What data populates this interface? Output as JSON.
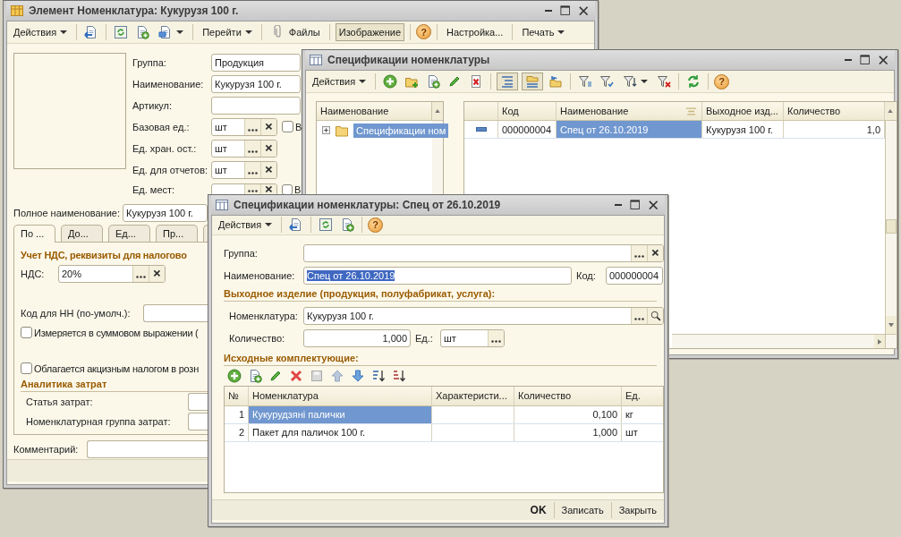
{
  "item_window": {
    "title": "Элемент Номенклатура: Кукурузя 100 г.",
    "toolbar": {
      "actions": "Действия",
      "goto": "Перейти",
      "files": "Файлы",
      "image": {
        "label": "Изображение",
        "pressed": true
      },
      "help": "?",
      "settings": "Настройка...",
      "print": "Печать"
    },
    "fields": [
      {
        "kind": "text",
        "label": "Группа:",
        "value": "Продукция"
      },
      {
        "kind": "text",
        "label": "Наименование:",
        "value": "Кукурузя 100 г."
      },
      {
        "kind": "text",
        "label": "Артикул:"
      },
      {
        "kind": "unit",
        "label": "Базовая ед.:",
        "value": "шт",
        "check_label": "В",
        "checked": false
      },
      {
        "kind": "unit",
        "label": "Ед. хран. ост.:",
        "value": "шт"
      },
      {
        "kind": "unit",
        "label": "Ед. для отчетов:",
        "value": "шт"
      },
      {
        "kind": "unit",
        "label": "Ед. мест:",
        "check_label": "В",
        "checked": false
      }
    ],
    "full_name": {
      "label": "Полное наименование:",
      "value": "Кукурузя 100 г."
    },
    "tabs": [
      {
        "label": "По ...",
        "selected": true
      },
      {
        "label": "До...",
        "selected": false
      },
      {
        "label": "Ед...",
        "selected": false
      },
      {
        "label": "Пр...",
        "selected": false
      },
      {
        "selected": false
      }
    ],
    "vat_section": {
      "title": "Учет НДС, реквизиты для налогово",
      "vat": {
        "label": "НДС:",
        "value": "20%"
      },
      "nn_code": {
        "label": "Код для НН (по-умолч.):"
      },
      "checks": [
        {
          "label": "Измеряется в суммовом выражении (",
          "checked": false
        },
        {
          "label": "Облагается акцизным налогом в розн",
          "checked": false
        }
      ]
    },
    "costs_section": {
      "title": "Аналитика затрат",
      "fields": [
        {
          "label": "Статья затрат:"
        },
        {
          "label": "Номенклатурная группа затрат:"
        }
      ]
    },
    "comment": {
      "label": "Комментарий:"
    }
  },
  "list_window": {
    "title": "Спецификации номенклатуры",
    "toolbar": {
      "actions": "Действия",
      "help": "?"
    },
    "tree": {
      "header": "Наименование",
      "items": [
        {
          "label": "Спецификации ном",
          "selected": true,
          "expanded": false
        }
      ]
    },
    "table": {
      "columns": [
        "Код",
        "Наименование",
        "Выходное изд...",
        "Количество"
      ],
      "rows": [
        {
          "code": "000000004",
          "name": "Спец от 26.10.2019",
          "product": "Кукурузя 100 г.",
          "quantity": "1,0",
          "selected": true
        }
      ]
    }
  },
  "spec_window": {
    "title": "Спецификации номенклатуры: Спец от 26.10.2019",
    "toolbar": {
      "actions": "Действия",
      "help": "?"
    },
    "group": {
      "label": "Группа:"
    },
    "name": {
      "label": "Наименование:",
      "value": "Спец от 26.10.2019",
      "selected_text": true
    },
    "code": {
      "label": "Код:",
      "value": "000000004"
    },
    "output_section": "Выходное изделие (продукция, полуфабрикат, услуга):",
    "nomenclature": {
      "label": "Номенклатура:",
      "value": "Кукурузя 100 г."
    },
    "quantity": {
      "label": "Количество:",
      "value": "1,000"
    },
    "unit": {
      "label": "Ед.:",
      "value": "шт"
    },
    "components_section": "Исходные комплектующие:",
    "table": {
      "columns": [
        "№",
        "Номенклатура",
        "Характеристи...",
        "Количество",
        "Ед."
      ],
      "rows": [
        {
          "n": "1",
          "name": "Кукурудзяні палички",
          "quantity": "0,100",
          "unit": "кг",
          "selected": true
        },
        {
          "n": "2",
          "name": "Пакет для паличок 100 г.",
          "quantity": "1,000",
          "unit": "шт",
          "selected": false
        }
      ]
    },
    "buttons": [
      {
        "label": "OK",
        "default": true
      },
      {
        "label": "Записать",
        "default": false
      },
      {
        "label": "Закрыть",
        "default": false
      }
    ]
  }
}
